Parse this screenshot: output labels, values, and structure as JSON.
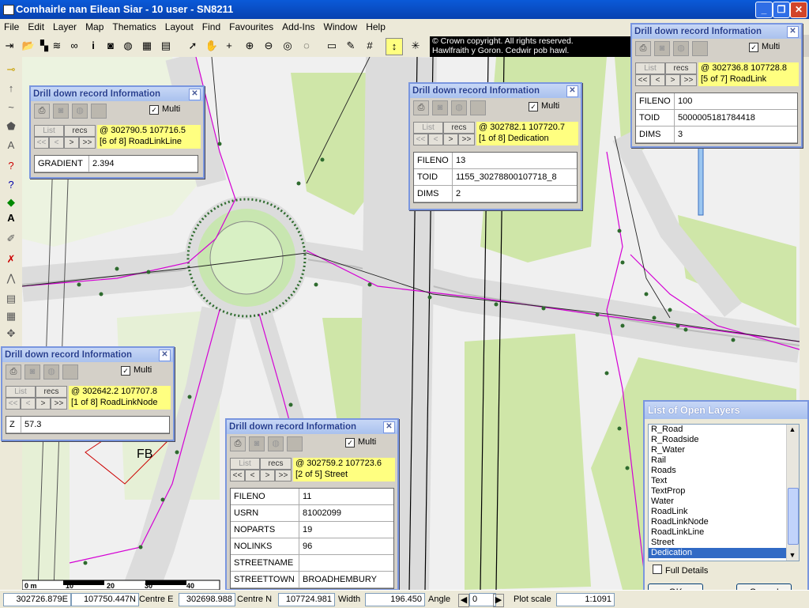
{
  "window": {
    "title": "Comhairle nan Eilean Siar - 10 user - SN8211",
    "minimize": "_",
    "maximize": "❐",
    "close": "✕"
  },
  "menu": [
    "File",
    "Edit",
    "Layer",
    "Map",
    "Thematics",
    "Layout",
    "Find",
    "Favourites",
    "Add-Ins",
    "Window",
    "Help"
  ],
  "copyright": {
    "line1": "© Crown copyright. All rights reserved.",
    "line2": "Hawlfraith y Goron. Cedwir pob hawl."
  },
  "map": {
    "label_fb": "FB",
    "scale_ticks": [
      "0 m",
      "10",
      "20",
      "30",
      "40"
    ]
  },
  "panels": [
    {
      "title": "Drill down record Information",
      "multi_label": "Multi",
      "list_label": "List",
      "recs_label": "recs",
      "coords": "@ 302790.5 107716.5",
      "record": "[6 of 8] RoadLinkLine",
      "nav": [
        "<<",
        "<",
        ">",
        ">>"
      ],
      "fields": [
        {
          "k": "GRADIENT",
          "v": "2.394"
        }
      ]
    },
    {
      "title": "Drill down record Information",
      "multi_label": "Multi",
      "list_label": "List",
      "recs_label": "recs",
      "coords": "@ 302782.1 107720.7",
      "record": "[1 of 8] Dedication",
      "nav": [
        "<<",
        "<",
        ">",
        ">>"
      ],
      "fields": [
        {
          "k": "FILENO",
          "v": "13"
        },
        {
          "k": "TOID",
          "v": "1155_30278800107718_8"
        },
        {
          "k": "DIMS",
          "v": "2"
        }
      ]
    },
    {
      "title": "Drill down record Information",
      "multi_label": "Multi",
      "list_label": "List",
      "recs_label": "recs",
      "coords": "@ 302736.8 107728.8",
      "record": "[5 of 7] RoadLink",
      "nav": [
        "<<",
        "<",
        ">",
        ">>"
      ],
      "fields": [
        {
          "k": "FILENO",
          "v": "100"
        },
        {
          "k": "TOID",
          "v": "5000005181784418"
        },
        {
          "k": "DIMS",
          "v": "3"
        }
      ]
    },
    {
      "title": "Drill down record Information",
      "multi_label": "Multi",
      "list_label": "List",
      "recs_label": "recs",
      "coords": "@ 302642.2 107707.8",
      "record": "[1 of 8] RoadLinkNode",
      "nav": [
        "<<",
        "<",
        ">",
        ">>"
      ],
      "fields": [
        {
          "k": "Z",
          "v": "57.3"
        }
      ]
    },
    {
      "title": "Drill down record Information",
      "multi_label": "Multi",
      "list_label": "List",
      "recs_label": "recs",
      "coords": "@ 302759.2 107723.6",
      "record": "[2 of 5] Street",
      "nav": [
        "<<",
        "<",
        ">",
        ">>"
      ],
      "fields": [
        {
          "k": "FILENO",
          "v": "11"
        },
        {
          "k": "USRN",
          "v": "81002099"
        },
        {
          "k": "NOPARTS",
          "v": "19"
        },
        {
          "k": "NOLINKS",
          "v": "96"
        },
        {
          "k": "STREETNAME",
          "v": ""
        },
        {
          "k": "STREETTOWN",
          "v": "BROADHEMBURY"
        }
      ]
    }
  ],
  "layers": {
    "title": "List of Open Layers",
    "items": [
      "R_Road",
      "R_Roadside",
      "R_Water",
      "Rail",
      "Roads",
      "Text",
      "TextProp",
      "Water",
      "RoadLink",
      "RoadLinkNode",
      "RoadLinkLine",
      "Street",
      "Dedication"
    ],
    "selected": "Dedication",
    "full_details": "Full Details",
    "ok": "OK",
    "cancel": "Cancel"
  },
  "status": {
    "x": "302726.879E",
    "y": "107750.447N",
    "centre_e_label": "Centre E",
    "centre_e": "302698.988",
    "centre_n_label": "Centre N",
    "centre_n": "107724.981",
    "width_label": "Width",
    "width": "196.450",
    "angle_label": "Angle",
    "angle": "0",
    "plot_scale_label": "Plot scale",
    "plot_scale": "1:1091"
  },
  "colors": {
    "green_fill": "#cfe6a8",
    "road_grey": "#dcdcdc",
    "magenta_line": "#d400d4",
    "node_green": "#2e6b2e",
    "highlight_yellow": "#ffff80"
  }
}
